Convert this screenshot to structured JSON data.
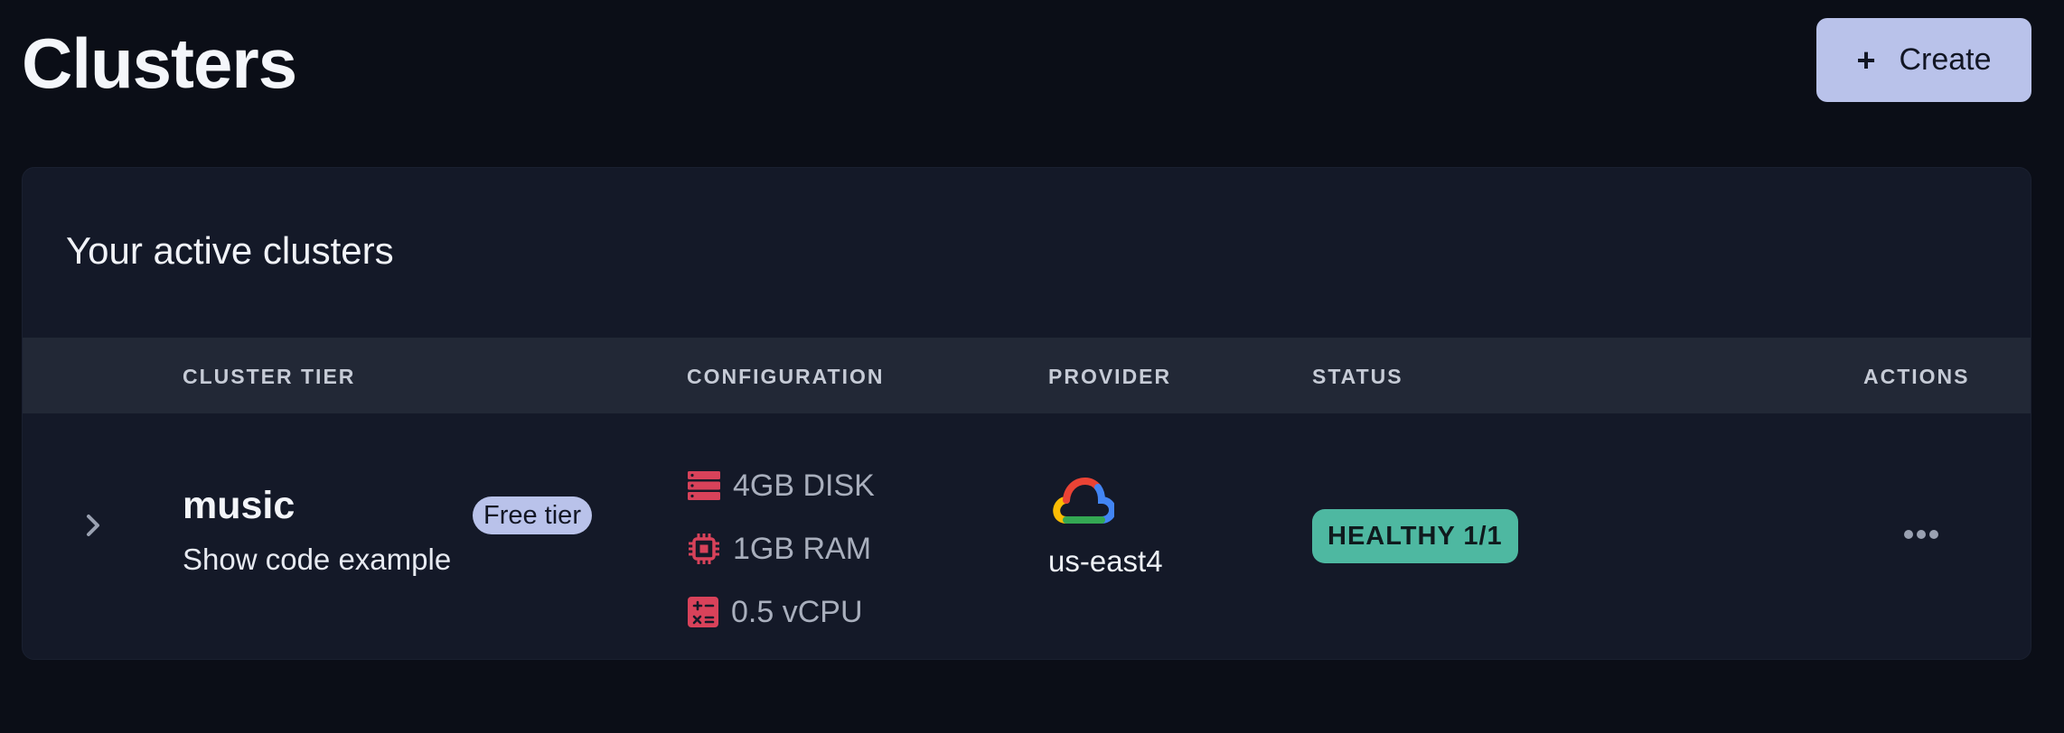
{
  "header": {
    "title": "Clusters",
    "create_icon": "plus",
    "create_label": "Create"
  },
  "card": {
    "title": "Your active clusters",
    "columns": [
      "CLUSTER TIER",
      "CONFIGURATION",
      "PROVIDER",
      "STATUS",
      "ACTIONS"
    ],
    "rows": [
      {
        "name": "music",
        "link": "Show code example",
        "tier": "Free tier",
        "config": [
          {
            "icon": "disk-icon",
            "label": "4GB DISK"
          },
          {
            "icon": "chip-icon",
            "label": "1GB RAM"
          },
          {
            "icon": "calculator-icon",
            "label": "0.5 vCPU"
          }
        ],
        "provider_icon": "google-cloud-icon",
        "region": "us-east4",
        "status": "HEALTHY 1/1"
      }
    ]
  },
  "colors": {
    "background": "#0b0e17",
    "card": "#141928",
    "accent": "#b9c2ea",
    "healthy": "#4eb8a1",
    "config_icon": "#d8425a"
  }
}
